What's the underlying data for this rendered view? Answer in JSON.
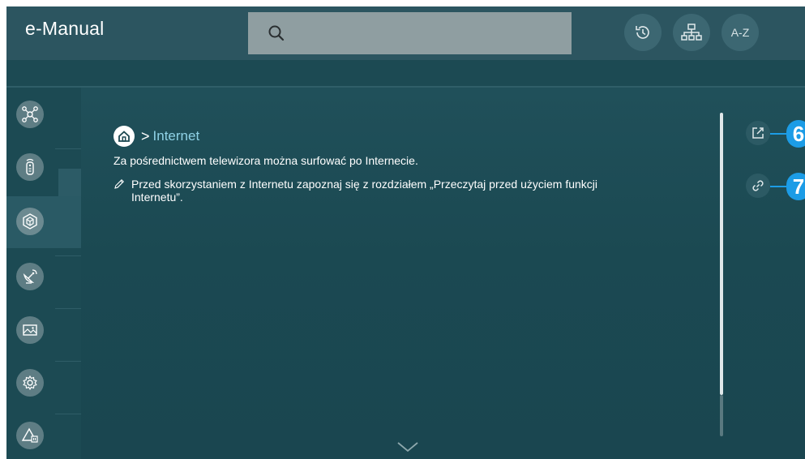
{
  "header": {
    "title": "e-Manual",
    "search_icon": "search-icon",
    "buttons": [
      {
        "name": "history",
        "icon": "history-icon"
      },
      {
        "name": "sitemap",
        "icon": "sitemap-icon"
      },
      {
        "name": "index",
        "label": "A-Z"
      }
    ]
  },
  "sidebar": {
    "items": [
      {
        "icon": "hub-icon"
      },
      {
        "icon": "remote-icon"
      },
      {
        "icon": "smart-features-icon",
        "active": true
      },
      {
        "icon": "satellite-icon"
      },
      {
        "icon": "picture-icon"
      },
      {
        "icon": "settings-icon"
      },
      {
        "icon": "warning-icon"
      }
    ]
  },
  "main": {
    "breadcrumb_separator": ">",
    "breadcrumb_current": "Internet",
    "body": "Za pośrednictwem telewizora można surfować po Internecie.",
    "note": "Przed skorzystaniem z Internetu zapoznaj się z rozdziałem „Przeczytaj przed użyciem funkcji Internetu”.",
    "callouts": [
      "6",
      "7"
    ]
  },
  "colors": {
    "accent": "#1c9ce6",
    "link": "#8fd2e6",
    "background": "#173f48"
  }
}
